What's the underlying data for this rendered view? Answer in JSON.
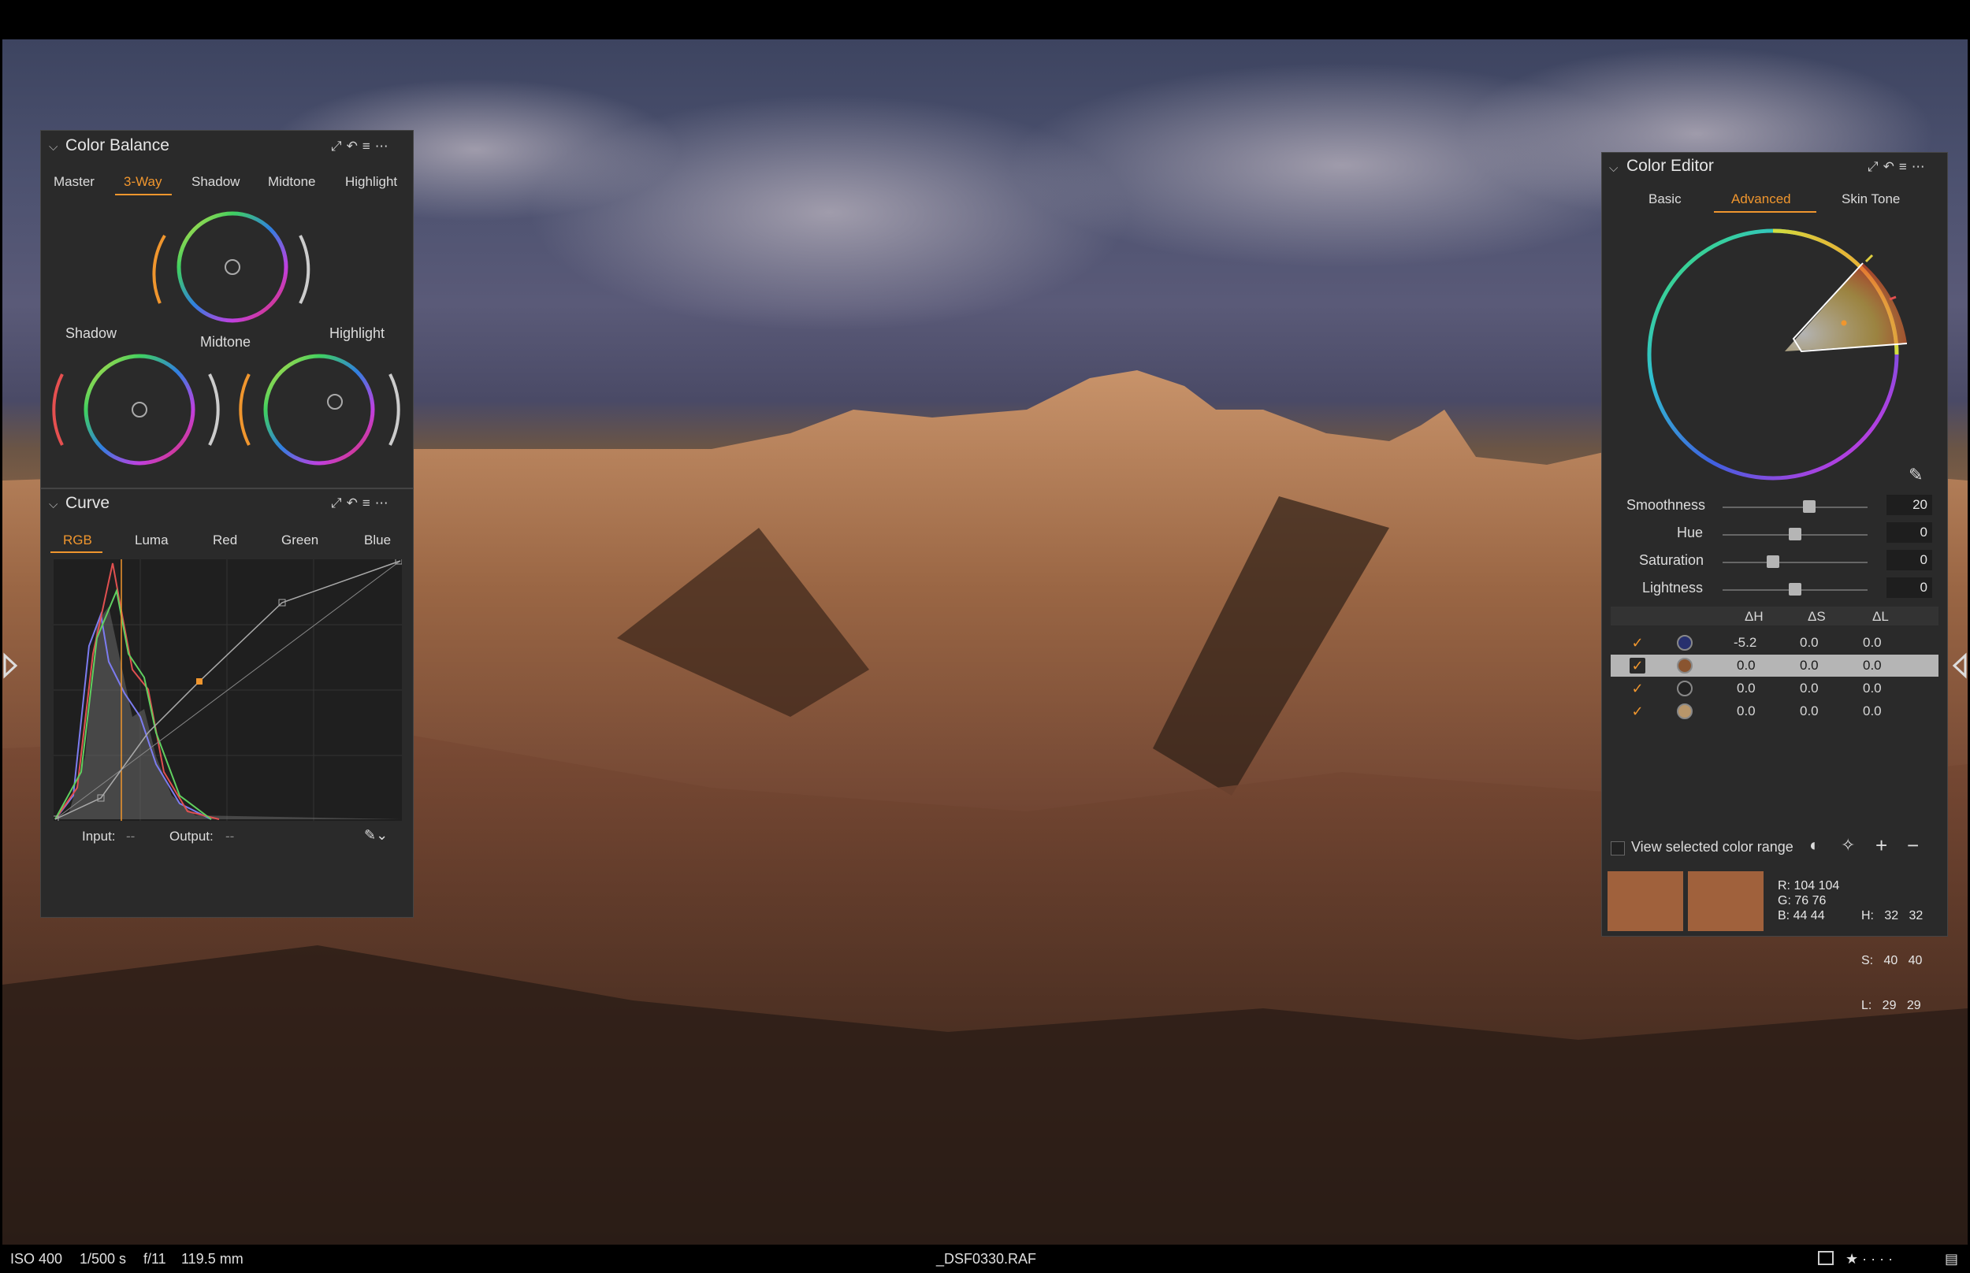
{
  "status_bar": {
    "iso": "ISO 400",
    "shutter": "1/500 s",
    "aperture": "f/11",
    "focal_length": "119.5 mm",
    "filename": "_DSF0330.RAF"
  },
  "color_balance": {
    "title": "Color Balance",
    "tabs": [
      "Master",
      "3-Way",
      "Shadow",
      "Midtone",
      "Highlight"
    ],
    "active_tab": "3-Way",
    "wheel_labels": {
      "shadow": "Shadow",
      "midtone": "Midtone",
      "highlight": "Highlight"
    }
  },
  "curve": {
    "title": "Curve",
    "tabs": [
      "RGB",
      "Luma",
      "Red",
      "Green",
      "Blue"
    ],
    "active_tab": "RGB",
    "input_label": "Input:",
    "input_value": "--",
    "output_label": "Output:",
    "output_value": "--"
  },
  "color_editor": {
    "title": "Color Editor",
    "tabs": [
      "Basic",
      "Advanced",
      "Skin Tone"
    ],
    "active_tab": "Advanced",
    "sliders": [
      {
        "label": "Smoothness",
        "value": "20",
        "level": 0.6
      },
      {
        "label": "Hue",
        "value": "0",
        "level": 0.5
      },
      {
        "label": "Saturation",
        "value": "0",
        "level": 0.35
      },
      {
        "label": "Lightness",
        "value": "0",
        "level": 0.5
      }
    ],
    "table_headers": [
      "ΔH",
      "ΔS",
      "ΔL"
    ],
    "rows": [
      {
        "color": "#27306e",
        "dh": "-5.2",
        "ds": "0.0",
        "dl": "0.0",
        "selected": false
      },
      {
        "color": "#8a5530",
        "dh": "0.0",
        "ds": "0.0",
        "dl": "0.0",
        "selected": true
      },
      {
        "color": "#222222",
        "dh": "0.0",
        "ds": "0.0",
        "dl": "0.0",
        "selected": false
      },
      {
        "color": "#b8966a",
        "dh": "0.0",
        "ds": "0.0",
        "dl": "0.0",
        "selected": false
      }
    ],
    "view_range_label": "View selected color range",
    "before_color": "#a0613c",
    "after_color": "#a0613c",
    "readout": {
      "r": "R: 104 104",
      "g": "G:  76  76",
      "b": "B:  44  44",
      "h": "H:   32   32",
      "s": "S:   40   40",
      "l": "L:   29   29"
    }
  },
  "accent_color": "#f0962e"
}
